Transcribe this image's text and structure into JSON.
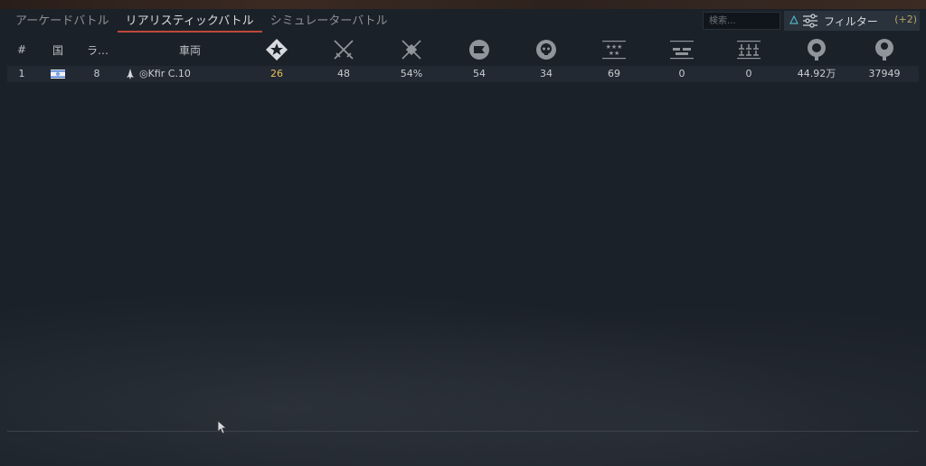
{
  "tabs": [
    {
      "label": "アーケードバトル",
      "active": false
    },
    {
      "label": "リアリスティックバトル",
      "active": true
    },
    {
      "label": "シミュレーターバトル",
      "active": false
    }
  ],
  "search": {
    "placeholder": "検索..."
  },
  "filter": {
    "label": "フィルター",
    "count": "(+2)"
  },
  "columns": {
    "index": "#",
    "nation": "国",
    "rank": "ラ…",
    "vehicle": "車両"
  },
  "stat_icons": [
    "ace-icon",
    "crossed-swords-icon",
    "victory-rate-icon",
    "flag-icon",
    "skull-icon",
    "stars-icon",
    "ground-targets-icon",
    "naval-targets-icon",
    "lion-icon",
    "research-icon"
  ],
  "rows": [
    {
      "index": "1",
      "nation": "israel-flag",
      "rank": "8",
      "vehicle": "◎Kfir C.10",
      "values": [
        "26",
        "48",
        "54%",
        "54",
        "34",
        "69",
        "0",
        "0",
        "44.92万",
        "37949"
      ]
    }
  ],
  "colors": {
    "accent": "#c0483a",
    "highlight": "#e7c25a",
    "filter_count": "#b9a567"
  }
}
